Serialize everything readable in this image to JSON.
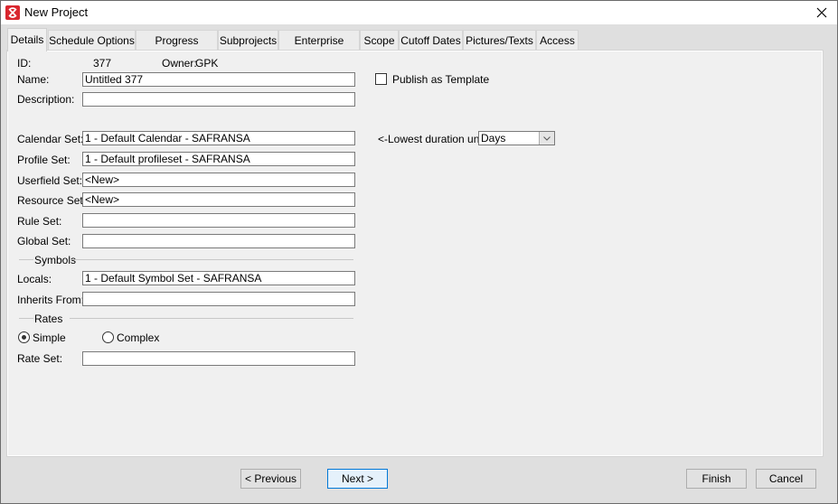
{
  "window": {
    "title": "New Project",
    "app_icon": "safran-logo-icon",
    "close_icon": "close-icon"
  },
  "tabs": [
    {
      "label": "Details",
      "active": true
    },
    {
      "label": "Schedule Options"
    },
    {
      "label": "Progress Method"
    },
    {
      "label": "Subprojects"
    },
    {
      "label": "Enterprise Fields"
    },
    {
      "label": "Scope"
    },
    {
      "label": "Cutoff Dates"
    },
    {
      "label": "Pictures/Texts"
    },
    {
      "label": "Access"
    }
  ],
  "details": {
    "id_label": "ID:",
    "id_value": "377",
    "owner_label": "Owner:",
    "owner_value": "GPK",
    "name_label": "Name:",
    "name_value": "Untitled 377",
    "description_label": "Description:",
    "description_value": "",
    "publish_template_label": "Publish as Template",
    "publish_template_checked": false,
    "calendar_set_label": "Calendar Set:",
    "calendar_set_value": "1 - Default Calendar - SAFRANSA",
    "lowest_duration_label": "<-Lowest duration units",
    "lowest_duration_value": "Days",
    "profile_set_label": "Profile Set:",
    "profile_set_value": "1 - Default profileset - SAFRANSA",
    "userfield_set_label": "Userfield Set:",
    "userfield_set_value": "<New>",
    "resource_set_label": "Resource Set:",
    "resource_set_value": "<New>",
    "rule_set_label": "Rule Set:",
    "rule_set_value": "",
    "global_set_label": "Global Set:",
    "global_set_value": "",
    "symbols_group": "Symbols",
    "locals_label": "Locals:",
    "locals_value": "1 - Default Symbol Set - SAFRANSA",
    "inherits_from_label": "Inherits From:",
    "inherits_from_value": "",
    "rates_group": "Rates",
    "rates_options": [
      {
        "label": "Simple",
        "selected": true
      },
      {
        "label": "Complex",
        "selected": false
      }
    ],
    "rate_set_label": "Rate Set:",
    "rate_set_value": ""
  },
  "footer": {
    "previous_label": "< Previous",
    "next_label": "Next >",
    "finish_label": "Finish",
    "cancel_label": "Cancel"
  }
}
